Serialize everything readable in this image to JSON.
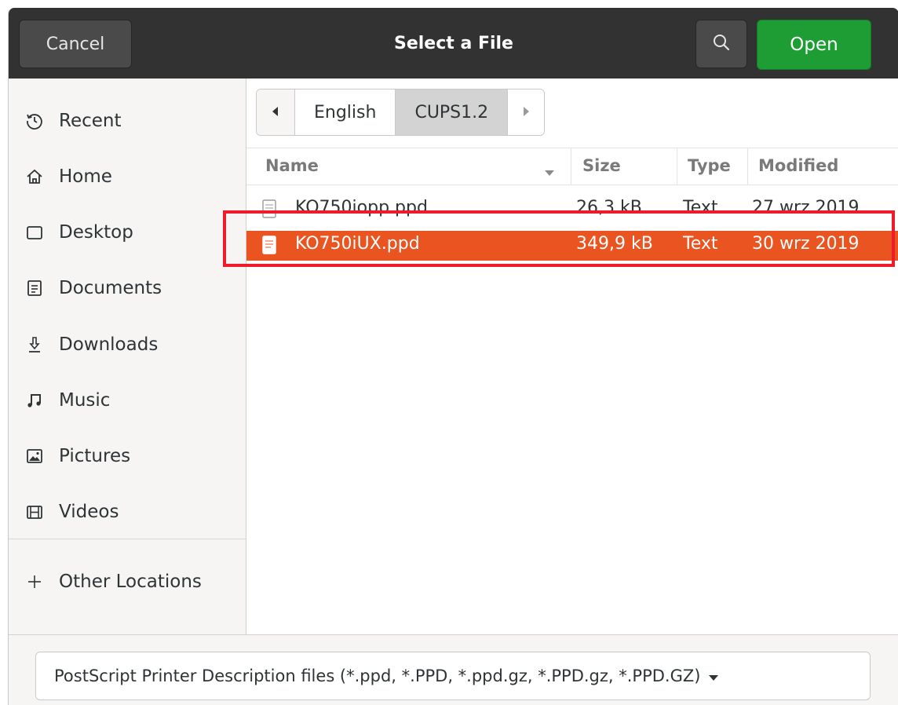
{
  "header": {
    "cancel_label": "Cancel",
    "title": "Select a File",
    "search_icon": "search-icon",
    "open_label": "Open"
  },
  "sidebar": {
    "items": [
      {
        "label": "Recent",
        "icon": "clock-icon"
      },
      {
        "label": "Home",
        "icon": "home-icon"
      },
      {
        "label": "Desktop",
        "icon": "desktop-icon"
      },
      {
        "label": "Documents",
        "icon": "documents-icon"
      },
      {
        "label": "Downloads",
        "icon": "downloads-icon"
      },
      {
        "label": "Music",
        "icon": "music-icon"
      },
      {
        "label": "Pictures",
        "icon": "pictures-icon"
      },
      {
        "label": "Videos",
        "icon": "videos-icon"
      },
      {
        "label": "Other Locations",
        "icon": "plus-icon"
      }
    ]
  },
  "pathbar": {
    "crumbs": [
      "English",
      "CUPS1.2"
    ],
    "active": "CUPS1.2"
  },
  "columns": {
    "name": "Name",
    "size": "Size",
    "type": "Type",
    "modified": "Modified"
  },
  "files": [
    {
      "name": "KO750iopp.ppd",
      "size": "26,3 kB",
      "type": "Text",
      "modified": "27 wrz 2019",
      "selected": false
    },
    {
      "name": "KO750iUX.ppd",
      "size": "349,9 kB",
      "type": "Text",
      "modified": "30 wrz 2019",
      "selected": true
    }
  ],
  "filter": {
    "label": "PostScript Printer Description files (*.ppd, *.PPD, *.ppd.gz, *.PPD.gz, *.PPD.GZ)"
  },
  "colors": {
    "headerbar": "#323232",
    "open_button": "#1e9d35",
    "selection": "#e95420",
    "highlight_box": "#ee1c2a"
  }
}
